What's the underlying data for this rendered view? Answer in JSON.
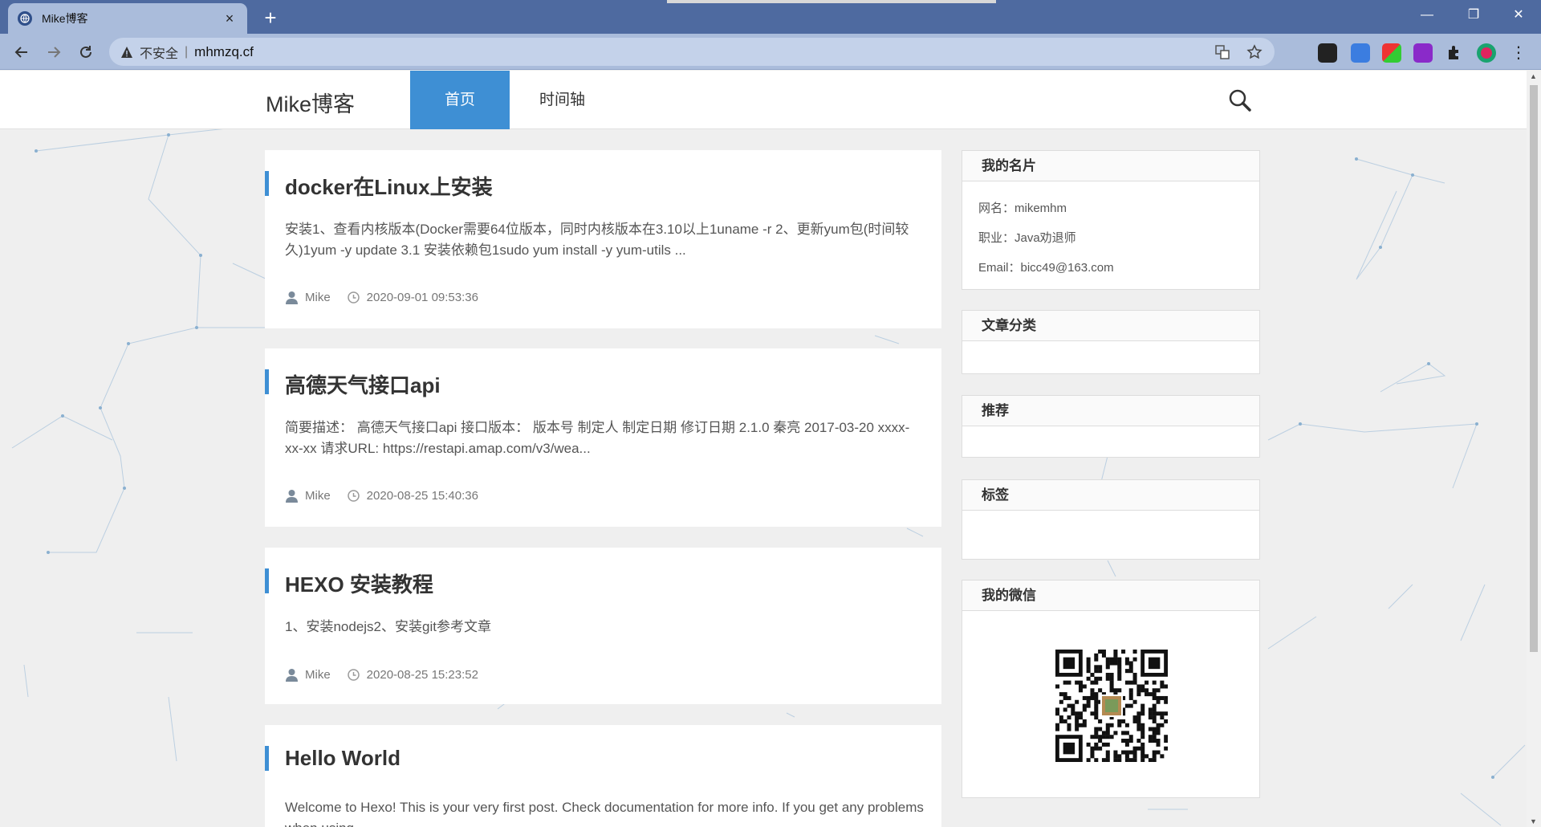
{
  "browser": {
    "tab_title": "Mike博客",
    "tab_close": "×",
    "new_tab": "+",
    "security_label": "不安全",
    "separator": "|",
    "url": "mhmzq.cf",
    "window_minimize": "—",
    "window_restore": "❐",
    "window_close": "✕"
  },
  "site": {
    "brand": "Mike博客",
    "nav": [
      {
        "label": "首页",
        "active": true
      },
      {
        "label": "时间轴",
        "active": false
      }
    ]
  },
  "posts": [
    {
      "title": "docker在Linux上安装",
      "excerpt": "安装1、查看内核版本(Docker需要64位版本，同时内核版本在3.10以上1uname -r 2、更新yum包(时间较久)1yum -y update 3.1 安装依赖包1sudo yum install -y yum-utils ...",
      "author": "Mike",
      "date": "2020-09-01 09:53:36"
    },
    {
      "title": "高德天气接口api",
      "excerpt": "简要描述： 高德天气接口api 接口版本： 版本号 制定人 制定日期 修订日期 2.1.0 秦亮 2017-03-20 xxxx-xx-xx 请求URL: https://restapi.amap.com/v3/wea...",
      "author": "Mike",
      "date": "2020-08-25 15:40:36"
    },
    {
      "title": "HEXO 安装教程",
      "excerpt": "1、安装nodejs2、安装git参考文章",
      "author": "Mike",
      "date": "2020-08-25 15:23:52"
    },
    {
      "title": "Hello World",
      "excerpt": "Welcome to Hexo! This is your very first post. Check documentation for more info. If you get any problems when using",
      "author": "",
      "date": ""
    }
  ],
  "sidebar": {
    "card": {
      "title": "我的名片",
      "lines": [
        "网名：mikemhm",
        "职业：Java劝退师",
        "Email：bicc49@163.com"
      ]
    },
    "categories": {
      "title": "文章分类"
    },
    "recommend": {
      "title": "推荐"
    },
    "tags": {
      "title": "标签"
    },
    "wechat": {
      "title": "我的微信"
    }
  },
  "colors": {
    "accent": "#3e8fd4",
    "tabstrip": "#4e6aa0",
    "toolbar": "#aabcdb"
  }
}
